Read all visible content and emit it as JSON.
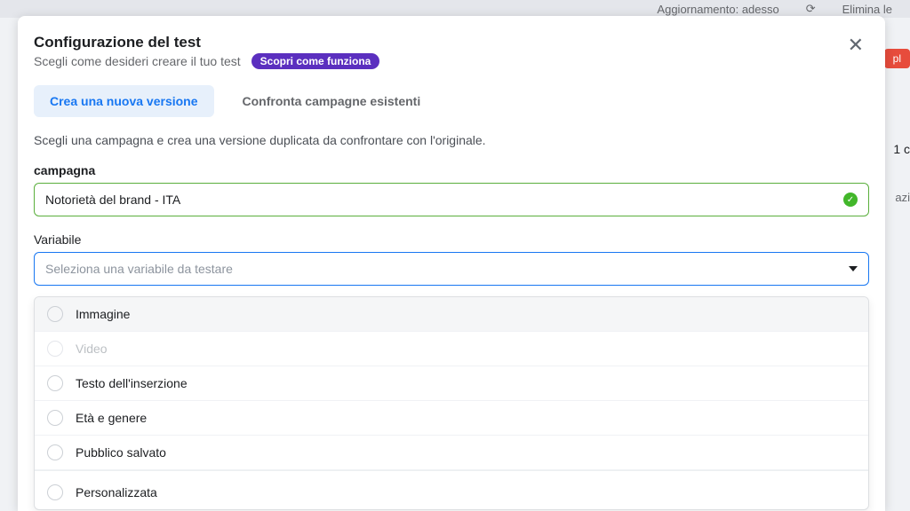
{
  "background": {
    "update_label": "Aggiornamento: adesso",
    "delete_label": "Elimina le",
    "pill": "pl",
    "count": "1 c",
    "side": "azi"
  },
  "modal": {
    "title": "Configurazione del test",
    "subtitle": "Scegli come desideri creare il tuo test",
    "learn_link": "Scopri come funziona"
  },
  "tabs": {
    "create": "Crea una nuova versione",
    "compare": "Confronta campagne esistenti"
  },
  "instruction": "Scegli una campagna e crea una versione duplicata da confrontare con l'originale.",
  "campaign": {
    "label": "campagna",
    "value": "Notorietà del brand - ITA"
  },
  "variable": {
    "label": "Variabile",
    "placeholder": "Seleziona una variabile da testare",
    "options": [
      {
        "label": "Immagine",
        "disabled": false,
        "hover": true
      },
      {
        "label": "Video",
        "disabled": true,
        "hover": false
      },
      {
        "label": "Testo dell'inserzione",
        "disabled": false,
        "hover": false
      },
      {
        "label": "Età e genere",
        "disabled": false,
        "hover": false
      },
      {
        "label": "Pubblico salvato",
        "disabled": false,
        "hover": false
      },
      {
        "label": "Personalizzata",
        "disabled": false,
        "hover": false
      }
    ]
  }
}
